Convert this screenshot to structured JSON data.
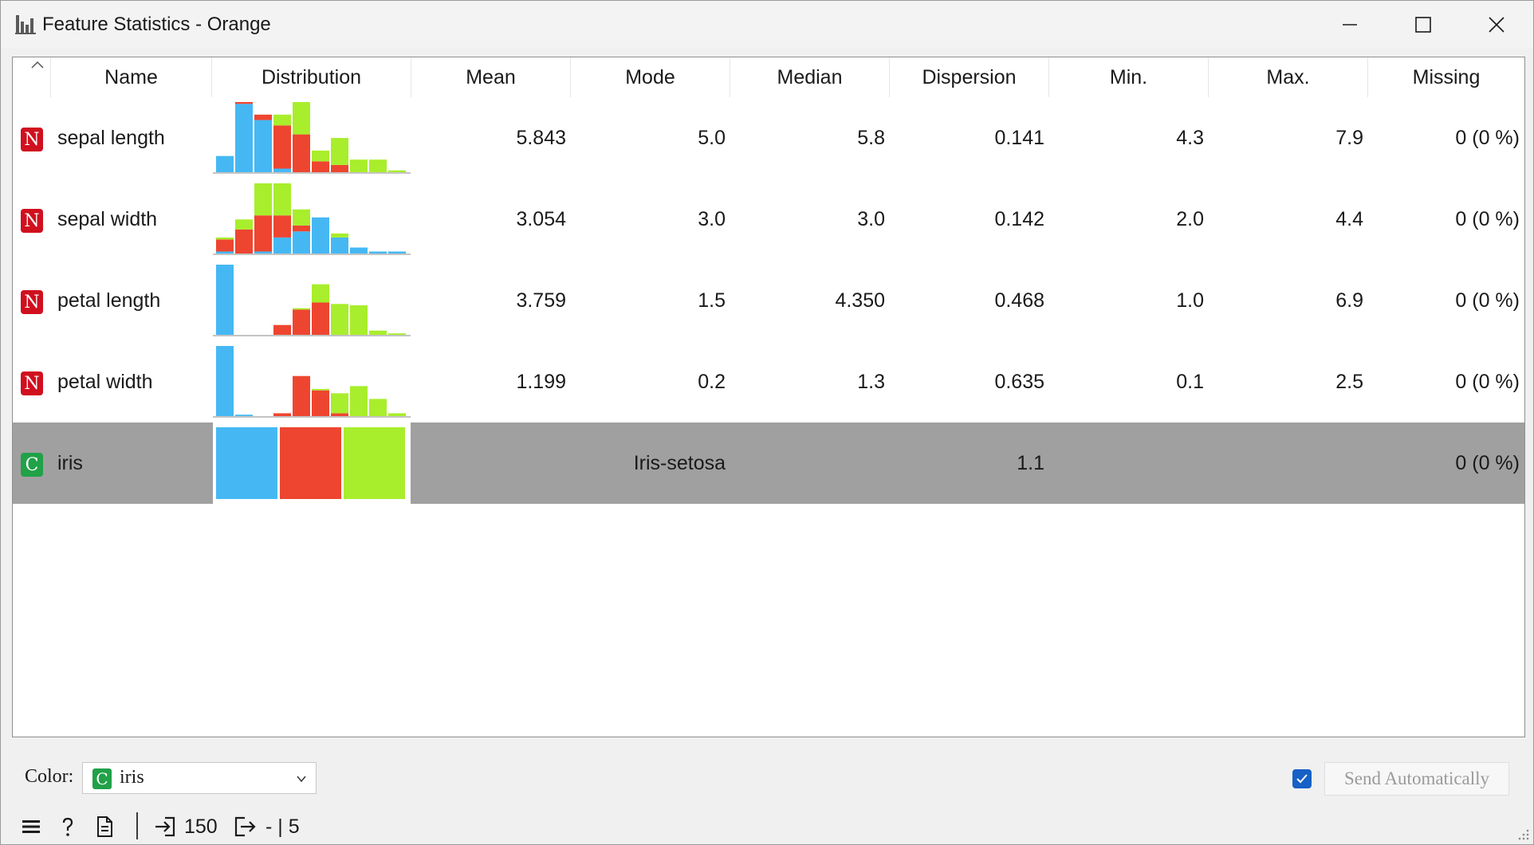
{
  "window": {
    "title": "Feature Statistics - Orange"
  },
  "table": {
    "columns": [
      "Name",
      "Distribution",
      "Mean",
      "Mode",
      "Median",
      "Dispersion",
      "Min.",
      "Max.",
      "Missing"
    ],
    "rows": [
      {
        "type": "N",
        "name": "sepal length",
        "mean": "5.843",
        "mode": "5.0",
        "median": "5.8",
        "dispersion": "0.141",
        "min": "4.3",
        "max": "7.9",
        "missing": "0 (0 %)"
      },
      {
        "type": "N",
        "name": "sepal width",
        "mean": "3.054",
        "mode": "3.0",
        "median": "3.0",
        "dispersion": "0.142",
        "min": "2.0",
        "max": "4.4",
        "missing": "0 (0 %)"
      },
      {
        "type": "N",
        "name": "petal length",
        "mean": "3.759",
        "mode": "1.5",
        "median": "4.350",
        "dispersion": "0.468",
        "min": "1.0",
        "max": "6.9",
        "missing": "0 (0 %)"
      },
      {
        "type": "N",
        "name": "petal width",
        "mean": "1.199",
        "mode": "0.2",
        "median": "1.3",
        "dispersion": "0.635",
        "min": "0.1",
        "max": "2.5",
        "missing": "0 (0 %)"
      },
      {
        "type": "C",
        "name": "iris",
        "mean": "",
        "mode": "Iris-setosa",
        "median": "",
        "dispersion": "1.1",
        "min": "",
        "max": "",
        "missing": "0 (0 %)"
      }
    ]
  },
  "distributions": {
    "colors": {
      "setosa": "#45b8f4",
      "versicolor": "#ee4530",
      "virginica": "#a8ee2c"
    },
    "histograms": [
      [
        [
          9,
          0,
          0
        ],
        [
          38,
          1,
          0
        ],
        [
          29,
          3,
          0
        ],
        [
          2,
          24,
          6
        ],
        [
          0,
          21,
          18
        ],
        [
          0,
          6,
          6
        ],
        [
          0,
          4,
          15
        ],
        [
          0,
          0,
          7
        ],
        [
          0,
          0,
          7
        ],
        [
          0,
          0,
          1
        ]
      ],
      [
        [
          1,
          6,
          1
        ],
        [
          0,
          12,
          5
        ],
        [
          1,
          18,
          16
        ],
        [
          8,
          11,
          16
        ],
        [
          11,
          3,
          8
        ],
        [
          18,
          0,
          0
        ],
        [
          8,
          0,
          2
        ],
        [
          3,
          0,
          0
        ],
        [
          1,
          0,
          0
        ],
        [
          1,
          0,
          0
        ]
      ],
      [
        [
          50,
          0,
          0
        ],
        [
          0,
          0,
          0
        ],
        [
          0,
          0,
          0
        ],
        [
          0,
          7,
          0
        ],
        [
          0,
          18,
          1
        ],
        [
          0,
          23,
          13
        ],
        [
          0,
          0,
          22
        ],
        [
          0,
          0,
          21
        ],
        [
          0,
          0,
          3
        ],
        [
          0,
          0,
          1
        ]
      ],
      [
        [
          49,
          0,
          0
        ],
        [
          1,
          0,
          0
        ],
        [
          0,
          0,
          0
        ],
        [
          0,
          2,
          0
        ],
        [
          0,
          28,
          0
        ],
        [
          0,
          18,
          1
        ],
        [
          0,
          2,
          14
        ],
        [
          0,
          0,
          21
        ],
        [
          0,
          0,
          12
        ],
        [
          0,
          0,
          2
        ]
      ]
    ],
    "class_counts": [
      50,
      50,
      50
    ]
  },
  "controls": {
    "color_label": "Color:",
    "color_value_badge": "C",
    "color_value": "iris",
    "send_auto_checked": true,
    "send_button": "Send Automatically"
  },
  "status": {
    "input_count": "150",
    "output_count": "- | 5"
  },
  "icons": [
    "app-histogram-icon",
    "minimize-icon",
    "maximize-icon",
    "close-icon",
    "sort-indicator-icon",
    "chevron-down-icon",
    "checkmark-icon",
    "menu-icon",
    "help-icon",
    "report-icon",
    "input-icon",
    "output-icon",
    "resize-grip-icon"
  ]
}
